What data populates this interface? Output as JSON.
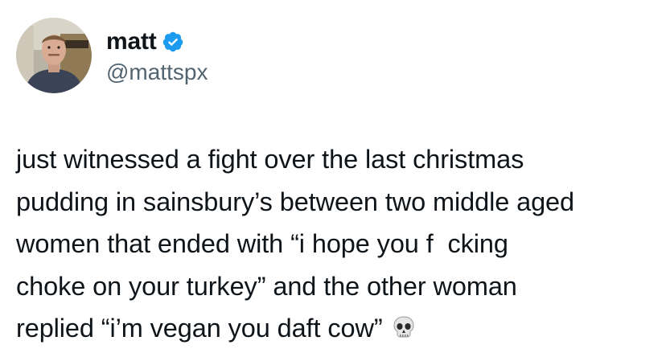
{
  "author": {
    "display_name": "matt",
    "handle": "@mattspx",
    "verified": true,
    "avatar_icon": "profile-photo"
  },
  "tweet": {
    "lines": [
      "just witnessed a fight over the last christmas",
      "pudding in sainsbury’s between two middle aged",
      "women that ended with “i hope you f  cking",
      "choke on your turkey” and the other woman",
      "replied “i’m vegan you daft cow”"
    ],
    "trailing_emoji": "skull"
  },
  "colors": {
    "text": "#0f1419",
    "secondary_text": "#536471",
    "verified_badge": "#1d9bf0",
    "background": "#ffffff"
  }
}
